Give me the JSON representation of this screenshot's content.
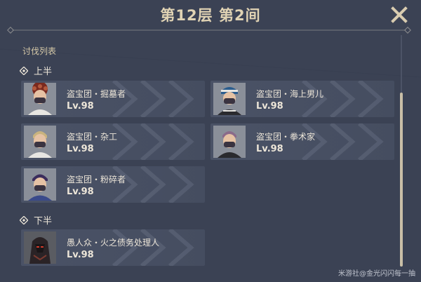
{
  "header": {
    "title": "第12层 第2间"
  },
  "list": {
    "label": "讨伐列表"
  },
  "halves": [
    {
      "label": "上半",
      "enemies": [
        {
          "name": "盗宝团・掘墓者",
          "level": "Lv.98"
        },
        {
          "name": "盗宝团・海上男儿",
          "level": "Lv.98"
        },
        {
          "name": "盗宝团・杂工",
          "level": "Lv.98"
        },
        {
          "name": "盗宝团・拳术家",
          "level": "Lv.98"
        },
        {
          "name": "盗宝团・粉碎者",
          "level": "Lv.98"
        }
      ]
    },
    {
      "label": "下半",
      "enemies": [
        {
          "name": "愚人众・火之债务处理人",
          "level": "Lv.98"
        }
      ]
    }
  ],
  "watermark": "米游社@金光闪闪每一抽",
  "colors": {
    "background": "#3b4254",
    "card": "#4a5266",
    "title": "#e0d3b4",
    "scrollbar": "#c9bfa7"
  },
  "icons": {
    "close": "close-icon",
    "half_marker": "diamond-icon"
  }
}
